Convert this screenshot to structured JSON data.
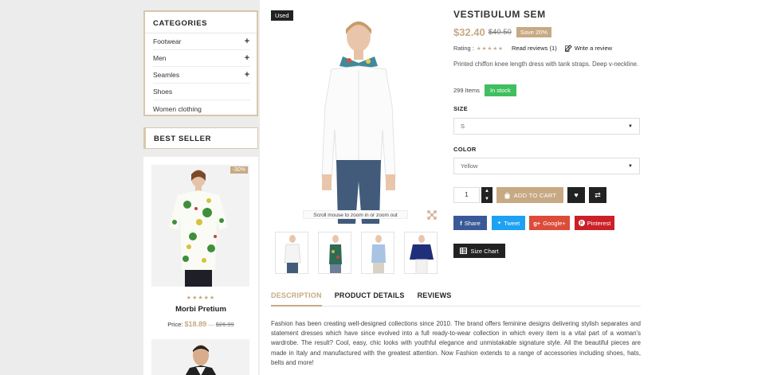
{
  "sidebar": {
    "categories_title": "CATEGORIES",
    "categories": [
      {
        "label": "Footwear",
        "expand": "+"
      },
      {
        "label": "Men",
        "expand": "+"
      },
      {
        "label": "Seamles",
        "expand": "+"
      },
      {
        "label": "Shoes",
        "expand": ""
      },
      {
        "label": "Women clothing",
        "expand": ""
      }
    ],
    "best_seller_title": "BEST SELLER",
    "best_seller": {
      "discount": "-30%",
      "stars": "★★★★★",
      "name": "Morbi Pretium",
      "price_label": "Price:",
      "price": "$18.89",
      "dash": "—",
      "old_price": "$26.99"
    }
  },
  "gallery": {
    "badge": "Used",
    "zoom_hint": "Scroll mouse to zoom in or zoom out"
  },
  "product": {
    "title": "VESTIBULUM SEM",
    "price": "$32.40",
    "old_price": "$40.50",
    "save": "Save 20%",
    "rating_label": "Rating :",
    "rating_stars": "★★★★★",
    "read_reviews": "Read reviews (1)",
    "write_review": "Write a review",
    "short_description": "Printed chiffon knee length dress with tank straps. Deep v-neckline.",
    "items_count": "299 Items",
    "stock_status": "In stock",
    "size_label": "SIZE",
    "size_value": "S",
    "color_label": "COLOR",
    "color_value": "Yellow",
    "qty": "1",
    "add_to_cart": "ADD TO CART",
    "size_chart": "Size Chart"
  },
  "share": {
    "facebook": "Share",
    "twitter": "Tweet",
    "google": "Google+",
    "pinterest": "Pinterest"
  },
  "colors": {
    "accent": "#c7a983",
    "facebook": "#3b5998",
    "twitter": "#1da1f2",
    "google": "#dd4b39",
    "pinterest": "#cb2027",
    "in_stock": "#3fbf5f"
  },
  "tabs": [
    "DESCRIPTION",
    "PRODUCT DETAILS",
    "REVIEWS"
  ],
  "description": "Fashion has been creating well-designed collections since 2010. The brand offers feminine designs delivering stylish separates and statement dresses which have since evolved into a full ready-to-wear collection in which every item is a vital part of a woman's wardrobe. The result? Cool, easy, chic looks with youthful elegance and unmistakable signature style. All the beautiful pieces are made in Italy and manufactured with the greatest attention. Now Fashion extends to a range of accessories including shoes, hats, belts and more!"
}
